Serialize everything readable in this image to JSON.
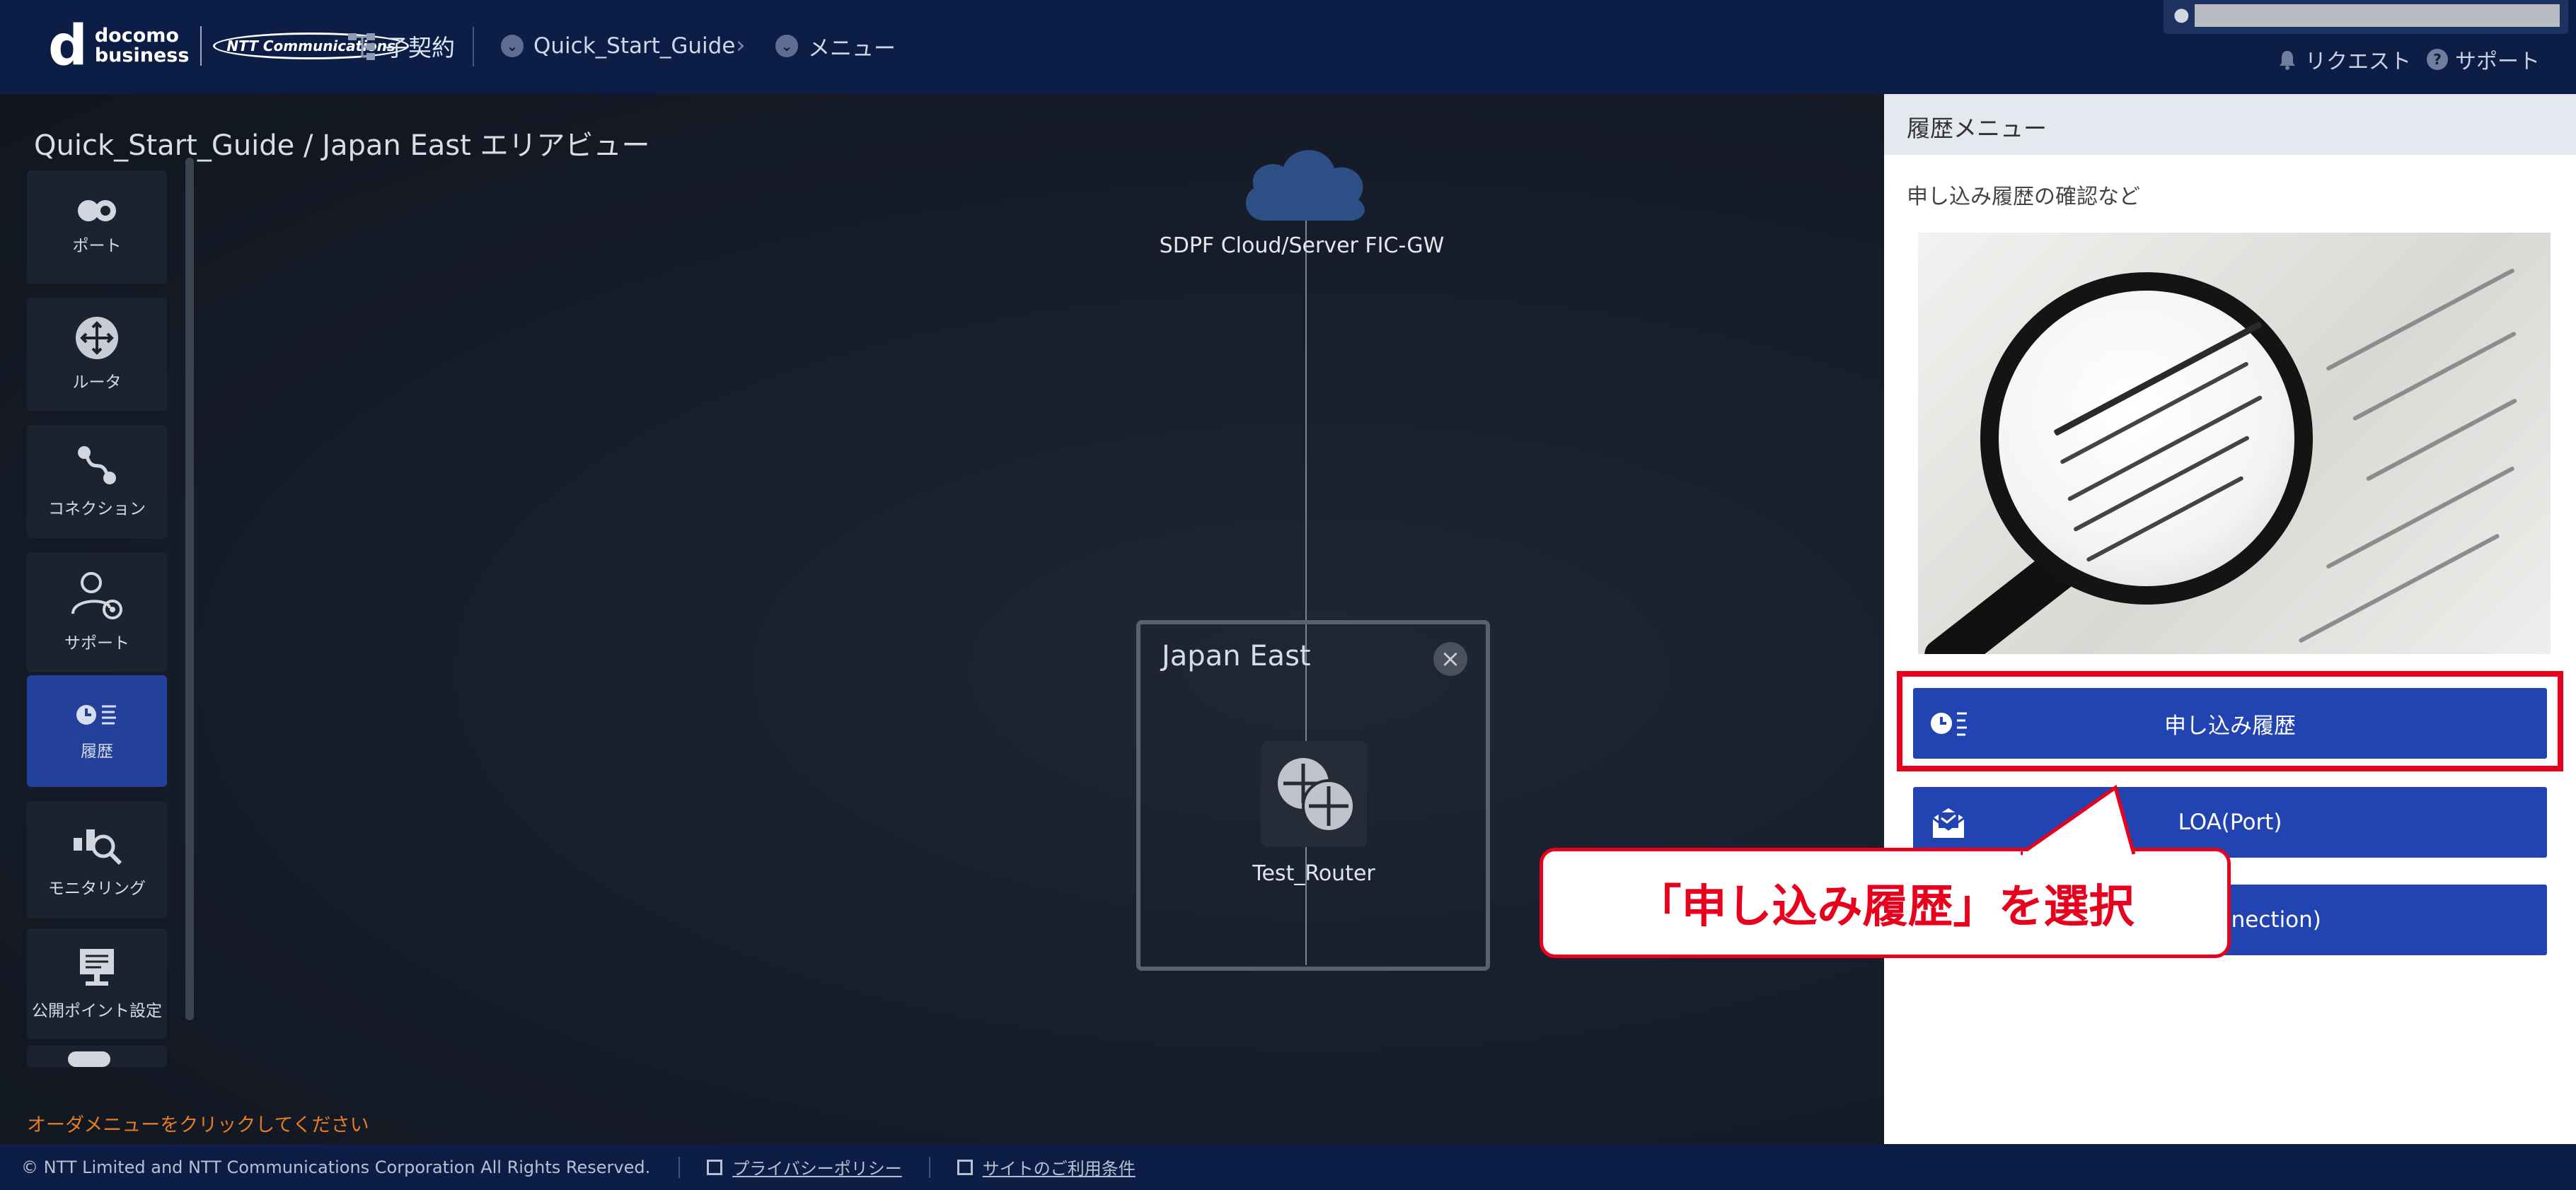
{
  "header": {
    "logo_mark": "d",
    "logo_line1": "docomo",
    "logo_line2": "business",
    "ntt_badge": "NTT Communications",
    "contract_label": "子契約",
    "breadcrumb": [
      "Quick_Start_Guide",
      "メニュー"
    ],
    "request_label": "リクエスト",
    "support_label": "サポート"
  },
  "canvas": {
    "view_title": "Quick_Start_Guide / Japan East エリアビュー",
    "order_message": "オーダメニューをクリックしてください"
  },
  "sidebar": {
    "items": [
      {
        "label": "ポート",
        "icon": "port-icon"
      },
      {
        "label": "ルータ",
        "icon": "router-icon"
      },
      {
        "label": "コネクション",
        "icon": "connection-icon"
      },
      {
        "label": "サポート",
        "icon": "support-user-icon"
      },
      {
        "label": "履歴",
        "icon": "history-icon",
        "active": true
      },
      {
        "label": "モニタリング",
        "icon": "monitoring-icon"
      },
      {
        "label": "公開ポイント設定",
        "icon": "public-point-icon"
      }
    ]
  },
  "diagram": {
    "cloud_label": "SDPF Cloud/Server FIC-GW",
    "area_title": "Japan East",
    "router_label": "Test_Router"
  },
  "callout": {
    "text": "「申し込み履歴」を選択"
  },
  "panel": {
    "title": "履歴メニュー",
    "description": "申し込み履歴の確認など",
    "buttons": [
      {
        "label": "申し込み履歴",
        "icon": "history-list-icon"
      },
      {
        "label": "LOA(Port)",
        "icon": "loa-document-icon"
      },
      {
        "label": "nnection)",
        "icon": ""
      }
    ]
  },
  "footer": {
    "copyright": "© NTT Limited and NTT Communications Corporation All Rights Reserved.",
    "privacy_link": "プライバシーポリシー",
    "terms_link": "サイトのご利用条件"
  },
  "colors": {
    "header_bg": "#0c1e45",
    "canvas_bg": "#161c29",
    "accent_blue": "#2244b3",
    "highlight_red": "#e8001c",
    "order_message": "#e27d23"
  }
}
